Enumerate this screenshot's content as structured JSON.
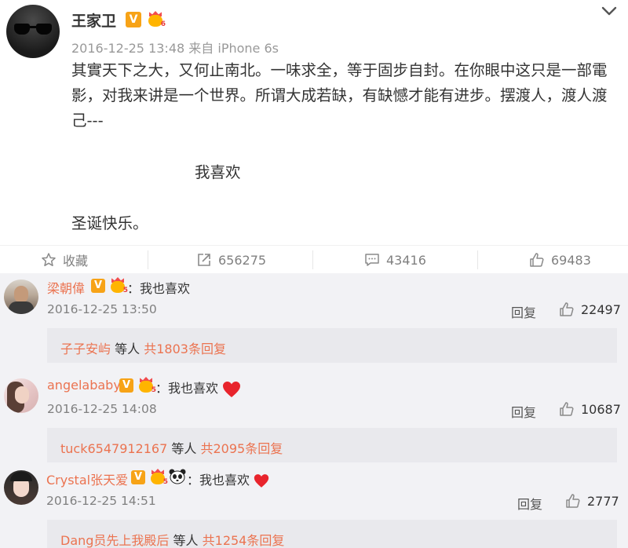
{
  "post": {
    "author": "王家卫",
    "verified_badge": "V",
    "level": "6",
    "timestamp": "2016-12-25 13:48",
    "source_prefix": "来自",
    "source": "iPhone 6s",
    "lines": [
      "其實天下之大，又何止南北。一味求全，等于固步自封。在你眼中这只是一部電",
      "影，对我来讲是一个世界。所谓大成若缺，有缺憾才能有进步。摆渡人，渡人渡",
      "己---"
    ],
    "center_line": "我喜欢",
    "tail_line": "圣诞快乐。"
  },
  "actions": {
    "favorite_label": "收藏",
    "repost_count": "656275",
    "comment_count": "43416",
    "like_count": "69483"
  },
  "comments": [
    {
      "user": "梁朝偉",
      "badge": "V",
      "level": "5",
      "text": "：我也喜欢",
      "time": "2016-12-25 13:50",
      "reply_label": "回复",
      "likes": "22497",
      "thread_user": "子子安屿",
      "thread_mid": "等人",
      "thread_count": "共1803条回复"
    },
    {
      "user": "angelababy",
      "badge": "V",
      "level": "5",
      "text": "：我也喜欢",
      "time": "2016-12-25 14:08",
      "reply_label": "回复",
      "likes": "10687",
      "thread_user": "tuck6547912167",
      "thread_mid": "等人",
      "thread_count": "共2095条回复"
    },
    {
      "user": "Crystal张天爱",
      "badge": "V",
      "level": "5",
      "text": "：我也喜欢",
      "time": "2016-12-25 14:51",
      "reply_label": "回复",
      "likes": "2777",
      "thread_user": "Dang员先上我殿后",
      "thread_mid": "等人",
      "thread_count": "共1254条回复"
    }
  ],
  "icons": {
    "verified": "verified-v-icon",
    "level": "crown-level-icon",
    "chevron": "chevron-down-icon",
    "favorite": "star-icon",
    "repost": "share-arrow-icon",
    "comment": "comment-bubble-icon",
    "like": "thumbs-up-icon",
    "heart": "heart-icon",
    "panda": "panda-icon"
  },
  "colors": {
    "link_orange": "#eb7350",
    "badge_orange": "#f7a317",
    "heart_red": "#e8242c",
    "comment_bg": "#f2f2f5"
  }
}
